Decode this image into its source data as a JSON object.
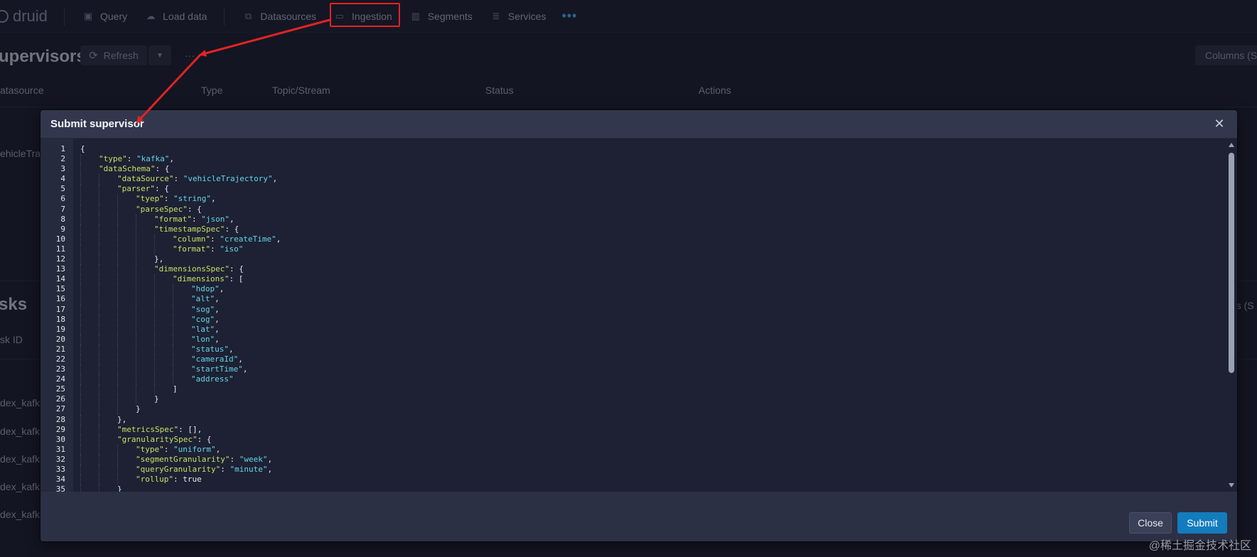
{
  "nav": {
    "brand": "druid",
    "items": [
      {
        "label": "Query",
        "icon": "query-icon",
        "glyph": "▣"
      },
      {
        "label": "Load data",
        "icon": "cloud-upload-icon",
        "glyph": "☁"
      },
      {
        "label": "Datasources",
        "icon": "datasources-icon",
        "glyph": "⧉"
      },
      {
        "label": "Ingestion",
        "icon": "ingestion-icon",
        "glyph": "▭"
      },
      {
        "label": "Segments",
        "icon": "segments-icon",
        "glyph": "▥"
      },
      {
        "label": "Services",
        "icon": "database-icon",
        "glyph": "≣"
      }
    ],
    "more": "•••"
  },
  "background": {
    "supervisors_title": "upervisors",
    "refresh_label": "Refresh",
    "columns_label": "Columns (S",
    "col_datasource": "atasource",
    "col_type": "Type",
    "col_topic": "Topic/Stream",
    "col_status": "Status",
    "col_actions": "Actions",
    "row_datasource": "ehicleTraje",
    "tasks_title": "sks",
    "col_task_id": "sk ID",
    "right_partial": "ns (S",
    "task_rows": [
      "dex_kafka_",
      "dex_kafka_",
      "dex_kafka_",
      "dex_kafka_",
      "dex_kafka_"
    ]
  },
  "modal": {
    "title": "Submit supervisor",
    "close_label": "Close",
    "submit_label": "Submit",
    "close_icon": "✕"
  },
  "editor": {
    "lines": [
      {
        "indent": 0,
        "tokens": [
          [
            "p",
            "{"
          ]
        ]
      },
      {
        "indent": 1,
        "tokens": [
          [
            "k",
            "\"type\""
          ],
          [
            "p",
            ": "
          ],
          [
            "s",
            "\"kafka\""
          ],
          [
            "p",
            ","
          ]
        ]
      },
      {
        "indent": 1,
        "tokens": [
          [
            "k",
            "\"dataSchema\""
          ],
          [
            "p",
            ": {"
          ]
        ]
      },
      {
        "indent": 2,
        "tokens": [
          [
            "k",
            "\"dataSource\""
          ],
          [
            "p",
            ": "
          ],
          [
            "s",
            "\"vehicleTrajectory\""
          ],
          [
            "p",
            ","
          ]
        ]
      },
      {
        "indent": 2,
        "tokens": [
          [
            "k",
            "\"parser\""
          ],
          [
            "p",
            ": {"
          ]
        ]
      },
      {
        "indent": 3,
        "tokens": [
          [
            "k",
            "\"tyep\""
          ],
          [
            "p",
            ": "
          ],
          [
            "s",
            "\"string\""
          ],
          [
            "p",
            ","
          ]
        ]
      },
      {
        "indent": 3,
        "tokens": [
          [
            "k",
            "\"parseSpec\""
          ],
          [
            "p",
            ": {"
          ]
        ]
      },
      {
        "indent": 4,
        "tokens": [
          [
            "k",
            "\"format\""
          ],
          [
            "p",
            ": "
          ],
          [
            "s",
            "\"json\""
          ],
          [
            "p",
            ","
          ]
        ]
      },
      {
        "indent": 4,
        "tokens": [
          [
            "k",
            "\"timestampSpec\""
          ],
          [
            "p",
            ": {"
          ]
        ]
      },
      {
        "indent": 5,
        "tokens": [
          [
            "k",
            "\"column\""
          ],
          [
            "p",
            ": "
          ],
          [
            "s",
            "\"createTime\""
          ],
          [
            "p",
            ","
          ]
        ]
      },
      {
        "indent": 5,
        "tokens": [
          [
            "k",
            "\"format\""
          ],
          [
            "p",
            ": "
          ],
          [
            "s",
            "\"iso\""
          ]
        ]
      },
      {
        "indent": 4,
        "tokens": [
          [
            "p",
            "},"
          ]
        ]
      },
      {
        "indent": 4,
        "tokens": [
          [
            "k",
            "\"dimensionsSpec\""
          ],
          [
            "p",
            ": {"
          ]
        ]
      },
      {
        "indent": 5,
        "tokens": [
          [
            "k",
            "\"dimensions\""
          ],
          [
            "p",
            ": ["
          ]
        ]
      },
      {
        "indent": 6,
        "tokens": [
          [
            "s",
            "\"hdop\""
          ],
          [
            "p",
            ","
          ]
        ]
      },
      {
        "indent": 6,
        "tokens": [
          [
            "s",
            "\"alt\""
          ],
          [
            "p",
            ","
          ]
        ]
      },
      {
        "indent": 6,
        "tokens": [
          [
            "s",
            "\"sog\""
          ],
          [
            "p",
            ","
          ]
        ]
      },
      {
        "indent": 6,
        "tokens": [
          [
            "s",
            "\"cog\""
          ],
          [
            "p",
            ","
          ]
        ]
      },
      {
        "indent": 6,
        "tokens": [
          [
            "s",
            "\"lat\""
          ],
          [
            "p",
            ","
          ]
        ]
      },
      {
        "indent": 6,
        "tokens": [
          [
            "s",
            "\"lon\""
          ],
          [
            "p",
            ","
          ]
        ]
      },
      {
        "indent": 6,
        "tokens": [
          [
            "s",
            "\"status\""
          ],
          [
            "p",
            ","
          ]
        ]
      },
      {
        "indent": 6,
        "tokens": [
          [
            "s",
            "\"cameraId\""
          ],
          [
            "p",
            ","
          ]
        ]
      },
      {
        "indent": 6,
        "tokens": [
          [
            "s",
            "\"startTime\""
          ],
          [
            "p",
            ","
          ]
        ]
      },
      {
        "indent": 6,
        "tokens": [
          [
            "s",
            "\"address\""
          ]
        ]
      },
      {
        "indent": 5,
        "tokens": [
          [
            "p",
            "]"
          ]
        ]
      },
      {
        "indent": 4,
        "tokens": [
          [
            "p",
            "}"
          ]
        ]
      },
      {
        "indent": 3,
        "tokens": [
          [
            "p",
            "}"
          ]
        ]
      },
      {
        "indent": 2,
        "tokens": [
          [
            "p",
            "},"
          ]
        ]
      },
      {
        "indent": 2,
        "tokens": [
          [
            "k",
            "\"metricsSpec\""
          ],
          [
            "p",
            ": [],"
          ]
        ]
      },
      {
        "indent": 2,
        "tokens": [
          [
            "k",
            "\"granularitySpec\""
          ],
          [
            "p",
            ": {"
          ]
        ]
      },
      {
        "indent": 3,
        "tokens": [
          [
            "k",
            "\"type\""
          ],
          [
            "p",
            ": "
          ],
          [
            "s",
            "\"uniform\""
          ],
          [
            "p",
            ","
          ]
        ]
      },
      {
        "indent": 3,
        "tokens": [
          [
            "k",
            "\"segmentGranularity\""
          ],
          [
            "p",
            ": "
          ],
          [
            "s",
            "\"week\""
          ],
          [
            "p",
            ","
          ]
        ]
      },
      {
        "indent": 3,
        "tokens": [
          [
            "k",
            "\"queryGranularity\""
          ],
          [
            "p",
            ": "
          ],
          [
            "s",
            "\"minute\""
          ],
          [
            "p",
            ","
          ]
        ]
      },
      {
        "indent": 3,
        "tokens": [
          [
            "k",
            "\"rollup\""
          ],
          [
            "p",
            ": true"
          ]
        ]
      },
      {
        "indent": 2,
        "tokens": [
          [
            "p",
            "}"
          ]
        ]
      }
    ]
  },
  "watermark": "@稀土掘金技术社区",
  "colors": {
    "accent": "#137cbd",
    "annotation": "#e02424",
    "key": "#c6e065",
    "string": "#62d6e8"
  }
}
